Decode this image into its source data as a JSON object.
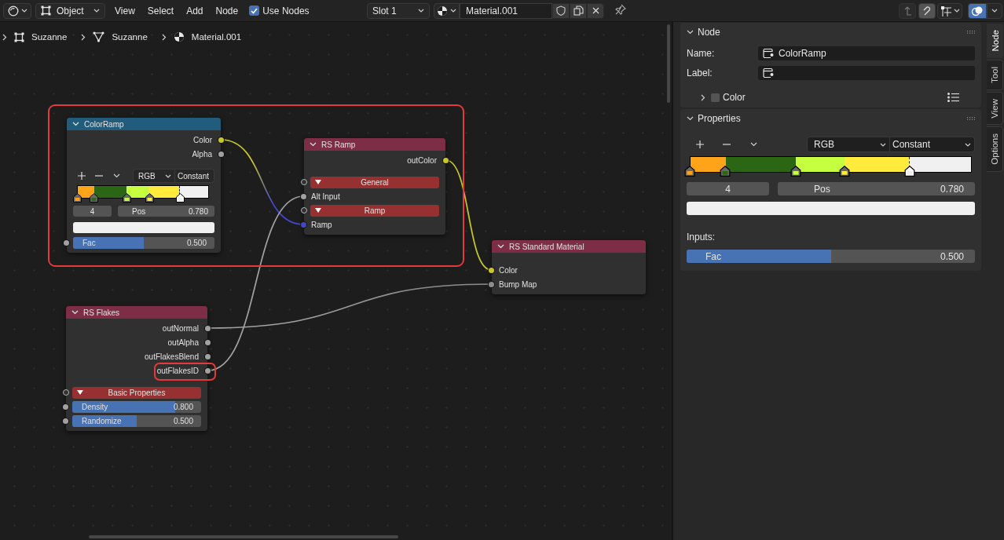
{
  "header": {
    "object_mode": "Object",
    "menus": [
      "View",
      "Select",
      "Add",
      "Node"
    ],
    "use_nodes": {
      "label": "Use Nodes",
      "checked": true
    },
    "slot": "Slot 1",
    "material": "Material.001",
    "snapping": {
      "on": true
    },
    "overlays": {
      "on": true
    }
  },
  "breadcrumbs": [
    {
      "kind": "object",
      "label": "Suzanne"
    },
    {
      "kind": "mesh",
      "label": "Suzanne"
    },
    {
      "kind": "material",
      "label": "Material.001"
    }
  ],
  "nodes": [
    {
      "title": "ColorRamp",
      "color": "#225c7c",
      "expanded": true,
      "rows": [
        {
          "kind": "output",
          "label": "Color",
          "color": "#c7c729"
        },
        {
          "kind": "output",
          "label": "Alpha",
          "color": "#a1a1a1"
        },
        {
          "kind": "ramp",
          "color_mode": "RGB",
          "interpolation": "Constant",
          "active_index": "4",
          "pos_label": "Pos",
          "pos_value": "0.780",
          "stops": [
            {
              "color": "#ffa31a",
              "level": 0,
              "selected": false
            },
            {
              "color": "#2a6614",
              "level": 0.125,
              "selected": false
            },
            {
              "color": "#c6ff3f",
              "level": 0.375,
              "selected": false
            },
            {
              "color": "#ffeb3b",
              "level": 0.55,
              "selected": false
            },
            {
              "color": "#f0f0f0",
              "level": 0.78,
              "selected": true
            }
          ]
        },
        {
          "kind": "slider",
          "label": "Fac",
          "value": "0.500",
          "level": 0.5,
          "color": "#a1a1a1"
        }
      ]
    },
    {
      "title": "RS Ramp",
      "color": "#7d2d45",
      "expanded": true,
      "rows": [
        {
          "kind": "output",
          "label": "outColor",
          "color": "#c7c729"
        },
        {
          "kind": "panel",
          "label": "General",
          "expanded": true
        },
        {
          "kind": "input",
          "label": "Alt Input",
          "color": "#a1a1a1"
        },
        {
          "kind": "panel",
          "label": "Ramp",
          "expanded": true
        },
        {
          "kind": "input",
          "label": "Ramp",
          "color": "#4545c8"
        }
      ]
    },
    {
      "title": "RS Standard Material",
      "color": "#7d2d45",
      "expanded": true,
      "rows": [
        {
          "kind": "input",
          "label": "Color",
          "color": "#c7c729"
        },
        {
          "kind": "input",
          "label": "Bump Map",
          "color": "#8c8c8c"
        }
      ]
    },
    {
      "title": "RS Flakes",
      "color": "#7d2d45",
      "expanded": true,
      "rows": [
        {
          "kind": "output",
          "label": "outNormal",
          "color": "#a1a1a1"
        },
        {
          "kind": "output",
          "label": "outAlpha",
          "color": "#a1a1a1"
        },
        {
          "kind": "output",
          "label": "outFlakesBlend",
          "color": "#a1a1a1"
        },
        {
          "kind": "output",
          "label": "outFlakesID",
          "color": "#a1a1a1"
        },
        {
          "kind": "panel",
          "label": "Basic Properties",
          "expanded": true
        },
        {
          "kind": "slider",
          "label": "Density",
          "value": "0.800",
          "level": 0.8,
          "color": "#a1a1a1"
        },
        {
          "kind": "slider",
          "label": "Randomize",
          "value": "0.500",
          "level": 0.5,
          "color": "#a1a1a1"
        }
      ]
    }
  ],
  "sidebar": {
    "tabs": [
      {
        "label": "Node",
        "selected": true
      },
      {
        "label": "Tool",
        "selected": false
      },
      {
        "label": "View",
        "selected": false
      },
      {
        "label": "Options",
        "selected": false
      }
    ],
    "node_panel": {
      "title": "Node",
      "expanded": true,
      "fields": [
        {
          "label": "Name:",
          "value": "ColorRamp"
        },
        {
          "label": "Label:"
        }
      ],
      "color_section": {
        "label": "Color",
        "expanded": false,
        "checked": false
      }
    },
    "properties_panel": {
      "title": "Properties",
      "expanded": true,
      "ramp": {
        "color_mode": "RGB",
        "interpolation": "Constant",
        "active_index": "4",
        "pos_label": "Pos",
        "pos_value": "0.780",
        "stops": [
          {
            "color": "#ffa31a",
            "level": 0,
            "selected": false
          },
          {
            "color": "#2a6614",
            "level": 0.125,
            "selected": false
          },
          {
            "color": "#c6ff3f",
            "level": 0.375,
            "selected": false
          },
          {
            "color": "#ffeb3b",
            "level": 0.55,
            "selected": false
          },
          {
            "color": "#f0f0f0",
            "level": 0.78,
            "selected": true
          }
        ]
      },
      "inputs_label": "Inputs:",
      "fac": {
        "label": "Fac",
        "value": "0.500",
        "level": 0.5
      }
    }
  }
}
